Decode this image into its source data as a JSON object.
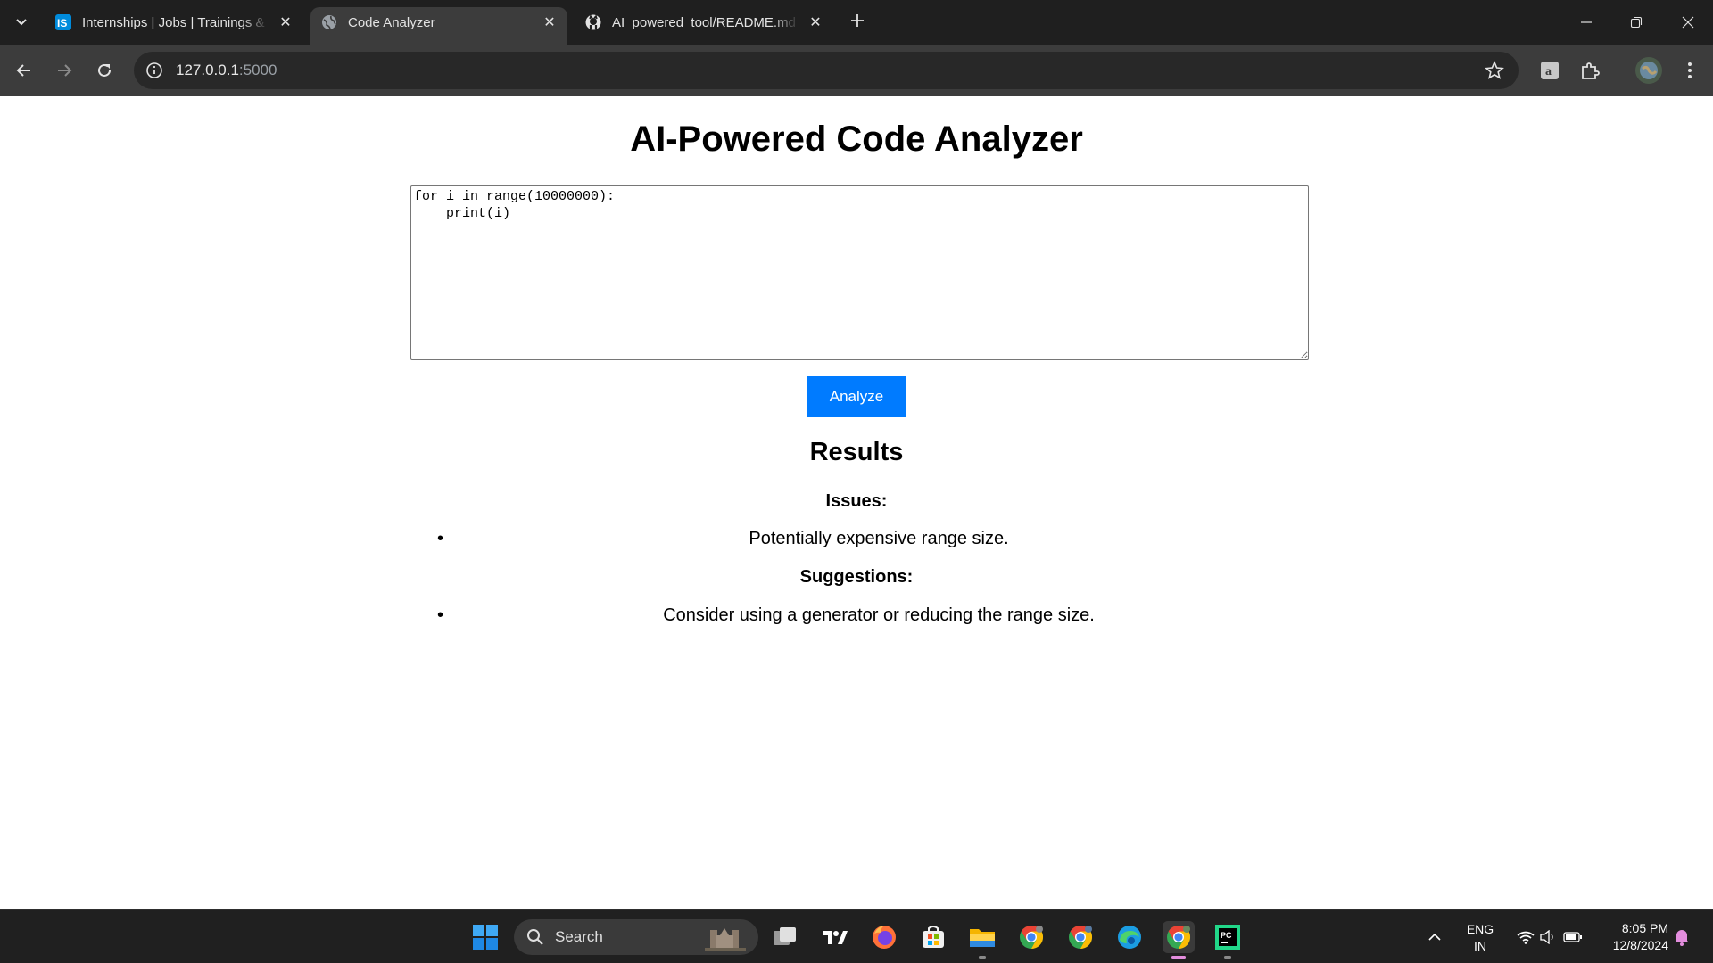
{
  "browser": {
    "tabs": [
      {
        "title": "Internships | Jobs | Trainings & Placements",
        "favicon": "internshala-icon",
        "active": false
      },
      {
        "title": "Code Analyzer",
        "favicon": "globe-icon",
        "active": true
      },
      {
        "title": "AI_powered_tool/README.md at main",
        "favicon": "github-icon",
        "active": false
      }
    ],
    "url_host": "127.0.0.1",
    "url_port": ":5000"
  },
  "page": {
    "title": "AI-Powered Code Analyzer",
    "code": "for i in range(10000000):\n    print(i)",
    "analyze_label": "Analyze",
    "results_heading": "Results",
    "issues_heading": "Issues:",
    "issues": [
      "Potentially expensive range size."
    ],
    "suggestions_heading": "Suggestions:",
    "suggestions": [
      "Consider using a generator or reducing the range size."
    ],
    "accent_color": "#007bff"
  },
  "taskbar": {
    "search_label": "Search",
    "language": "ENG",
    "region": "IN",
    "time": "8:05 PM",
    "date": "12/8/2024"
  }
}
